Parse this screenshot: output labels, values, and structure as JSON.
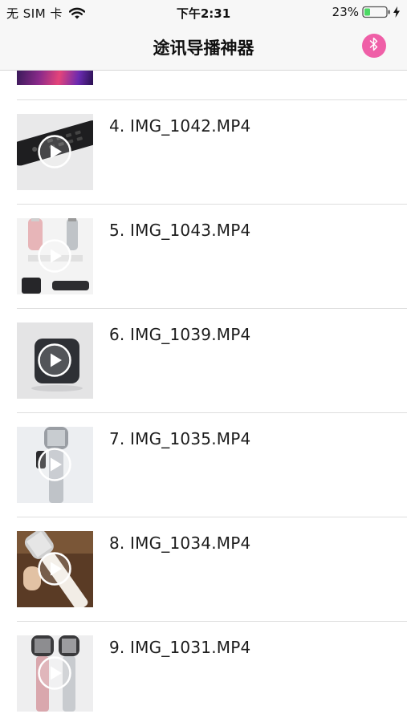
{
  "status_bar": {
    "carrier": "无 SIM 卡",
    "time": "下午2:31",
    "battery": "23%",
    "icons": [
      "wifi-icon",
      "battery-icon",
      "charging-bolt-icon"
    ]
  },
  "nav": {
    "title": "途讯导播神器",
    "right_icon": "bluetooth-icon",
    "accent_color": "#ef5fa7"
  },
  "videos": [
    {
      "label": "4. IMG_1042.MP4",
      "thumb": "remote-control"
    },
    {
      "label": "5. IMG_1043.MP4",
      "thumb": "microphones-and-box"
    },
    {
      "label": "6. IMG_1039.MP4",
      "thumb": "speaker-cube"
    },
    {
      "label": "7. IMG_1035.MP4",
      "thumb": "microphone-silver"
    },
    {
      "label": "8. IMG_1034.MP4",
      "thumb": "microphone-in-hand"
    },
    {
      "label": "9. IMG_1031.MP4",
      "thumb": "microphones-pair"
    }
  ]
}
